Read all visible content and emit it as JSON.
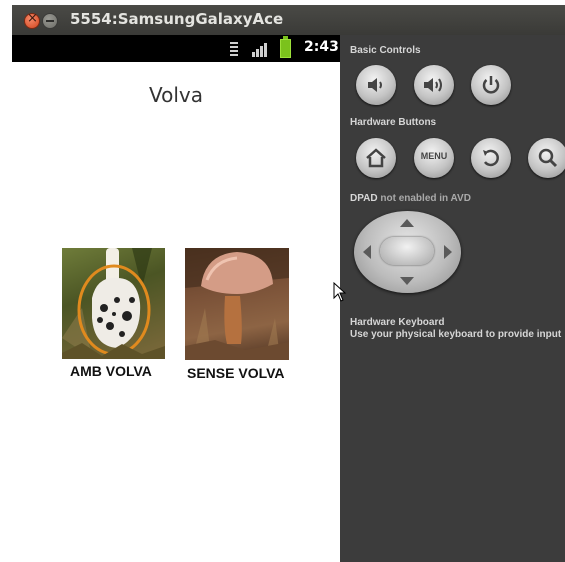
{
  "window": {
    "title": "5554:SamsungGalaxyAce"
  },
  "statusbar": {
    "time": "2:43"
  },
  "app": {
    "title": "Volva",
    "options": [
      {
        "label": "AMB VOLVA"
      },
      {
        "label": "SENSE VOLVA"
      }
    ]
  },
  "controls": {
    "basic_header": "Basic Controls",
    "hardware_header": "Hardware Buttons",
    "menu_label": "MENU",
    "dpad_header": "DPAD",
    "dpad_note": "not enabled in AVD",
    "keyboard_header": "Hardware Keyboard",
    "keyboard_note": "Use your physical keyboard to provide input"
  },
  "colors": {
    "panel_bg": "#3c3c3c",
    "battery": "#7bc21c",
    "highlight_ring": "#e08a1e"
  },
  "icons": [
    "close-icon",
    "minimize-icon",
    "data-icon",
    "signal-icon",
    "battery-icon",
    "volume-down-icon",
    "volume-up-icon",
    "power-icon",
    "home-icon",
    "back-icon",
    "search-icon",
    "mouse-cursor-icon"
  ]
}
